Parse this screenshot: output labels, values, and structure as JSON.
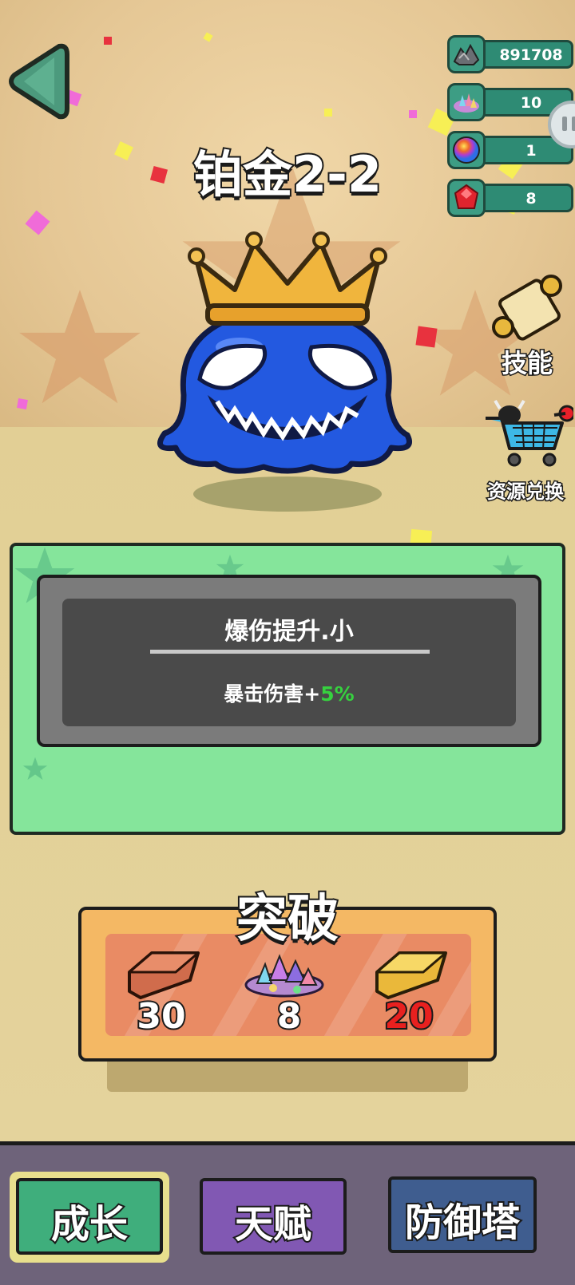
{
  "stage": {
    "title": "铂金2-2"
  },
  "resources": [
    {
      "name": "scrap-metal",
      "value": "891708"
    },
    {
      "name": "crystal-pile",
      "value": "10"
    },
    {
      "name": "rainbow-orb",
      "value": "1"
    },
    {
      "name": "red-gem",
      "value": "8"
    }
  ],
  "side_buttons": {
    "skills_label": "技能",
    "exchange_label": "资源兑换"
  },
  "upgrade_card": {
    "title": "爆伤提升.小",
    "desc_prefix": "暴击伤害+",
    "desc_value": "5%"
  },
  "breakthrough": {
    "title": "突破",
    "costs": [
      {
        "item": "copper-bar",
        "amount": "30",
        "insufficient": false
      },
      {
        "item": "crystal-pile",
        "amount": "8",
        "insufficient": false
      },
      {
        "item": "gold-bar",
        "amount": "20",
        "insufficient": true
      }
    ]
  },
  "nav": {
    "tabs": [
      {
        "label": "成长",
        "active": true,
        "color": "#3fae7c"
      },
      {
        "label": "天赋",
        "active": false,
        "color": "#8158b3"
      },
      {
        "label": "防御塔",
        "active": false,
        "color": "#3f5d8f"
      }
    ]
  },
  "colors": {
    "panel": "#85e59b",
    "accent_green": "#36d13f",
    "cost_insufficient": "#e8201f"
  }
}
